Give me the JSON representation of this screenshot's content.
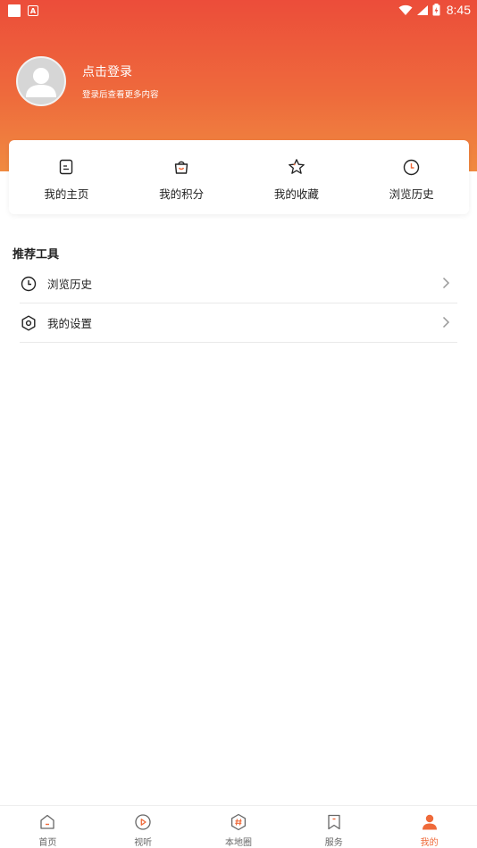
{
  "status_bar": {
    "time": "8:45"
  },
  "profile": {
    "login_title": "点击登录",
    "login_subtitle": "登录后查看更多内容"
  },
  "quick_actions": [
    {
      "label": "我的主页",
      "icon": "note-icon"
    },
    {
      "label": "我的积分",
      "icon": "shopping-bag-icon"
    },
    {
      "label": "我的收藏",
      "icon": "star-icon"
    },
    {
      "label": "浏览历史",
      "icon": "clock-icon"
    }
  ],
  "tools": {
    "title": "推荐工具",
    "items": [
      {
        "label": "浏览历史",
        "icon": "clock-icon"
      },
      {
        "label": "我的设置",
        "icon": "settings-hexagon-icon"
      }
    ]
  },
  "tabbar": {
    "items": [
      {
        "label": "首页",
        "icon": "home-icon",
        "active": false
      },
      {
        "label": "视听",
        "icon": "play-circle-icon",
        "active": false
      },
      {
        "label": "本地圈",
        "icon": "hashtag-hexagon-icon",
        "active": false
      },
      {
        "label": "服务",
        "icon": "bookmark-icon",
        "active": false
      },
      {
        "label": "我的",
        "icon": "person-icon",
        "active": true
      }
    ]
  },
  "colors": {
    "header_top": "#ec4d3a",
    "header_bottom": "#f08a40",
    "accent": "#ef6a3a",
    "text": "#222222",
    "tab_inactive": "#666666"
  }
}
